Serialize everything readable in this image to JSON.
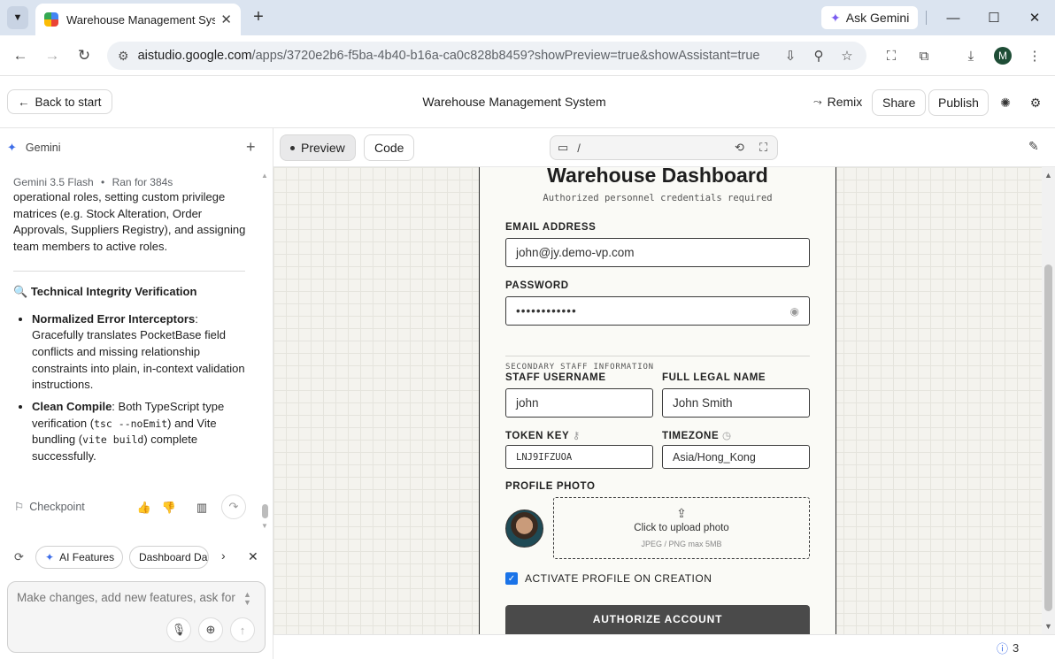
{
  "browser": {
    "tab_title": "Warehouse Management System",
    "url_host": "aistudio.google.com",
    "url_path": "/apps/3720e2b6-f5ba-4b40-b16a-ca0c828b8459?showPreview=true&showAssistant=true",
    "ask_gemini_label": "Ask Gemini",
    "profile_initial": "M"
  },
  "header": {
    "back_label": "Back to start",
    "title": "Warehouse Management System",
    "remix_label": "Remix",
    "share_label": "Share",
    "publish_label": "Publish"
  },
  "assistant": {
    "name": "Gemini",
    "model": "Gemini 3.5 Flash",
    "run_info": "Ran for 384s",
    "intro_text": "operational roles, setting custom privilege matrices (e.g. Stock Alteration, Order Approvals, Suppliers Registry), and assigning team members to active roles.",
    "section_title": "Technical Integrity Verification",
    "bullet1_title": "Normalized Error Interceptors",
    "bullet1_text": ": Gracefully translates PocketBase field conflicts and missing relationship constraints into plain, in-context validation instructions.",
    "bullet2_title": "Clean Compile",
    "bullet2_text_a": ": Both TypeScript type verification (",
    "bullet2_code_a": "tsc --noEmit",
    "bullet2_text_b": ") and Vite bundling (",
    "bullet2_code_b": "vite build",
    "bullet2_text_c": ") complete successfully.",
    "checkpoint_label": "Checkpoint",
    "chips": [
      "AI Features",
      "Dashboard Dat"
    ],
    "prompt_placeholder": "Make changes, add new features, ask for"
  },
  "preview": {
    "tab_preview": "Preview",
    "tab_code": "Code",
    "path": "/",
    "issues_count": "3"
  },
  "form": {
    "title": "Warehouse Dashboard",
    "subtitle": "Authorized personnel credentials required",
    "email_label": "EMAIL ADDRESS",
    "email_value": "john@jy.demo-vp.com",
    "password_label": "PASSWORD",
    "password_value": "••••••••••••",
    "section_label": "SECONDARY STAFF INFORMATION",
    "username_label": "STAFF USERNAME",
    "username_value": "john",
    "fullname_label": "FULL LEGAL NAME",
    "fullname_value": "John Smith",
    "token_label": "TOKEN KEY",
    "token_value": "LNJ9IFZUOA",
    "timezone_label": "TIMEZONE",
    "timezone_value": "Asia/Hong_Kong",
    "photo_label": "PROFILE PHOTO",
    "upload_text": "Click to upload photo",
    "upload_hint": "JPEG / PNG max 5MB",
    "activate_label": "ACTIVATE PROFILE ON CREATION",
    "activate_checked": true,
    "submit_label": "AUTHORIZE ACCOUNT"
  },
  "colors": {
    "accent": "#1a73e8",
    "gemini": "#3d6de8",
    "submit_bg": "#4a4a4a"
  }
}
